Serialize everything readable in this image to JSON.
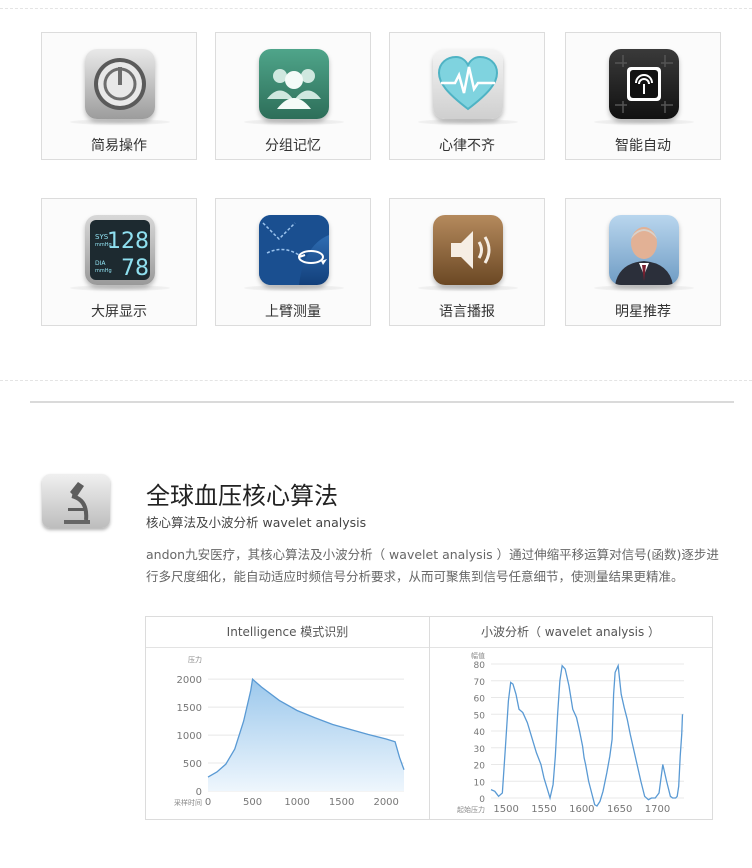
{
  "features": [
    {
      "label": "简易操作",
      "icon": "power-button-icon"
    },
    {
      "label": "分组记忆",
      "icon": "user-group-icon"
    },
    {
      "label": "心律不齐",
      "icon": "heart-rhythm-icon"
    },
    {
      "label": "智能自动",
      "icon": "chip-icon"
    },
    {
      "label": "大屏显示",
      "icon": "lcd-display-icon",
      "display": {
        "sys_label": "SYS",
        "sys_unit": "mmHg",
        "sys_value": "128",
        "dia_label": "DIA",
        "dia_unit": "mmHg",
        "dia_value": "78"
      }
    },
    {
      "label": "上臂测量",
      "icon": "upper-arm-icon"
    },
    {
      "label": "语言播报",
      "icon": "speaker-icon"
    },
    {
      "label": "明星推荐",
      "icon": "celebrity-photo-icon"
    }
  ],
  "section": {
    "icon": "microscope-icon",
    "title": "全球血压核心算法",
    "subtitle": "核心算法及小波分析 wavelet analysis",
    "description": "andon九安医疗，其核心算法及小波分析（ wavelet analysis ）通过伸缩平移运算对信号(函数)逐步进行多尺度细化，能自动适应时频信号分析要求，从而可聚焦到信号任意细节，使测量结果更精准。"
  },
  "chart_data": [
    {
      "type": "area",
      "title": "Intelligence 模式识别",
      "ylabel": "压力",
      "xlabel": "采样时间",
      "xlim": [
        0,
        2200
      ],
      "ylim": [
        0,
        2200
      ],
      "xticks": [
        "0",
        "500",
        "1000",
        "1500",
        "2000"
      ],
      "yticks": [
        "0",
        "500",
        "1000",
        "1500",
        "2000"
      ],
      "x": [
        0,
        100,
        200,
        300,
        400,
        480,
        500,
        600,
        800,
        1000,
        1200,
        1400,
        1600,
        1800,
        2000,
        2100,
        2150,
        2200
      ],
      "y": [
        250,
        340,
        480,
        750,
        1250,
        1800,
        2000,
        1860,
        1620,
        1440,
        1310,
        1190,
        1100,
        1010,
        930,
        880,
        600,
        380
      ]
    },
    {
      "type": "line",
      "title": "小波分析（ wavelet analysis ）",
      "ylabel": "幅值",
      "xlabel": "起始压力",
      "xlim": [
        1480,
        1735
      ],
      "ylim": [
        0,
        80
      ],
      "xticks": [
        "1500",
        "1550",
        "1600",
        "1650",
        "1700"
      ],
      "yticks": [
        "0",
        "10",
        "20",
        "30",
        "40",
        "50",
        "60",
        "70",
        "80"
      ],
      "x": [
        1480,
        1485,
        1490,
        1495,
        1499,
        1503,
        1506,
        1509,
        1513,
        1517,
        1522,
        1528,
        1534,
        1540,
        1546,
        1550,
        1554,
        1558,
        1562,
        1565,
        1568,
        1571,
        1574,
        1578,
        1583,
        1588,
        1593,
        1597,
        1601,
        1603,
        1605,
        1607,
        1609,
        1613,
        1617,
        1620,
        1624,
        1628,
        1633,
        1637,
        1640,
        1642,
        1644,
        1648,
        1652,
        1656,
        1660,
        1664,
        1668,
        1673,
        1678,
        1683,
        1688,
        1692,
        1697,
        1702,
        1707,
        1712,
        1717,
        1720,
        1722,
        1724,
        1726,
        1728,
        1730,
        1732,
        1733
      ],
      "y": [
        5,
        4,
        1,
        3,
        30,
        58,
        69,
        68,
        62,
        53,
        51,
        45,
        36,
        27,
        20,
        12,
        6,
        0,
        8,
        25,
        50,
        70,
        79,
        77,
        67,
        53,
        48,
        40,
        31,
        24,
        20,
        15,
        10,
        3,
        -4,
        -5,
        -2,
        4,
        15,
        25,
        35,
        62,
        75,
        79,
        62,
        54,
        47,
        38,
        30,
        20,
        10,
        1,
        -1,
        0,
        0,
        3,
        20,
        10,
        1,
        0,
        0,
        0,
        1,
        7,
        25,
        38,
        50
      ]
    }
  ]
}
